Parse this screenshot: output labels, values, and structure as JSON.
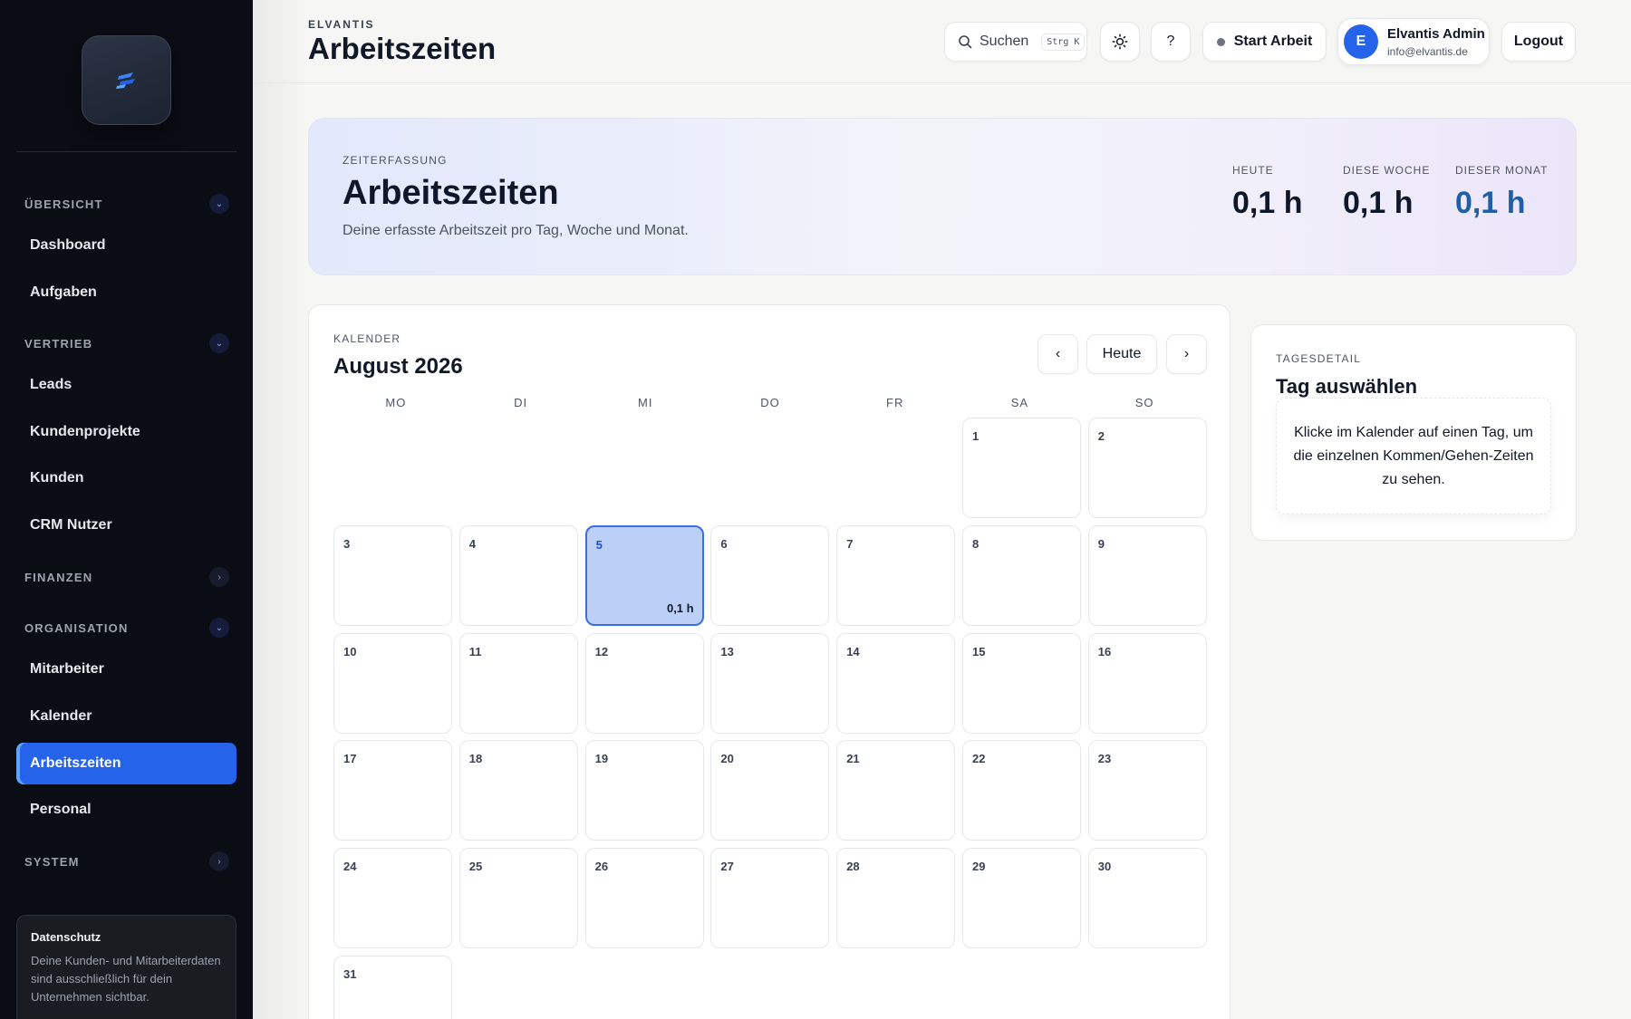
{
  "sidebar": {
    "sections": [
      {
        "label": "ÜBERSICHT",
        "expanded": true,
        "items": [
          "Dashboard",
          "Aufgaben"
        ]
      },
      {
        "label": "VERTRIEB",
        "expanded": true,
        "items": [
          "Leads",
          "Kundenprojekte",
          "Kunden",
          "CRM Nutzer"
        ]
      },
      {
        "label": "FINANZEN",
        "expanded": false,
        "items": []
      },
      {
        "label": "ORGANISATION",
        "expanded": true,
        "items": [
          "Mitarbeiter",
          "Kalender",
          "Arbeitszeiten",
          "Personal"
        ]
      },
      {
        "label": "SYSTEM",
        "expanded": false,
        "items": []
      }
    ],
    "active_item": "Arbeitszeiten",
    "privacy": {
      "title": "Datenschutz",
      "text": "Deine Kunden- und Mitarbeiterdaten sind ausschließlich für dein Unternehmen sichtbar."
    }
  },
  "header": {
    "brand": "ELVANTIS",
    "title": "Arbeitszeiten",
    "search_label": "Suchen",
    "search_shortcut": "Strg K",
    "help_label": "?",
    "start_label": "Start Arbeit",
    "user": {
      "initial": "E",
      "name": "Elvantis Admin",
      "email": "info@elvantis.de"
    },
    "logout_label": "Logout"
  },
  "hero": {
    "kicker": "ZEITERFASSUNG",
    "title": "Arbeitszeiten",
    "subtitle": "Deine erfasste Arbeitszeit pro Tag, Woche und Monat.",
    "stats": [
      {
        "label": "HEUTE",
        "value": "0,1 h"
      },
      {
        "label": "DIESE WOCHE",
        "value": "0,1 h"
      },
      {
        "label": "DIESER MONAT",
        "value": "0,1 h"
      }
    ]
  },
  "calendar": {
    "kicker": "KALENDER",
    "month_title": "August 2026",
    "prev_label": "‹",
    "today_label": "Heute",
    "next_label": "›",
    "weekdays": [
      "MO",
      "DI",
      "MI",
      "DO",
      "FR",
      "SA",
      "SO"
    ],
    "leading_blanks": 5,
    "days_in_month": 31,
    "selected_day": 5,
    "day_hours": {
      "5": "0,1 h"
    }
  },
  "detail": {
    "kicker": "TAGESDETAIL",
    "title": "Tag auswählen",
    "empty_text": "Klicke im Kalender auf einen Tag, um die einzelnen Kommen/Gehen-Zeiten zu sehen."
  },
  "colors": {
    "accent": "#2563eb",
    "sidebar_bg": "#0b0d14",
    "stat_accent": "#1d5fa8"
  }
}
